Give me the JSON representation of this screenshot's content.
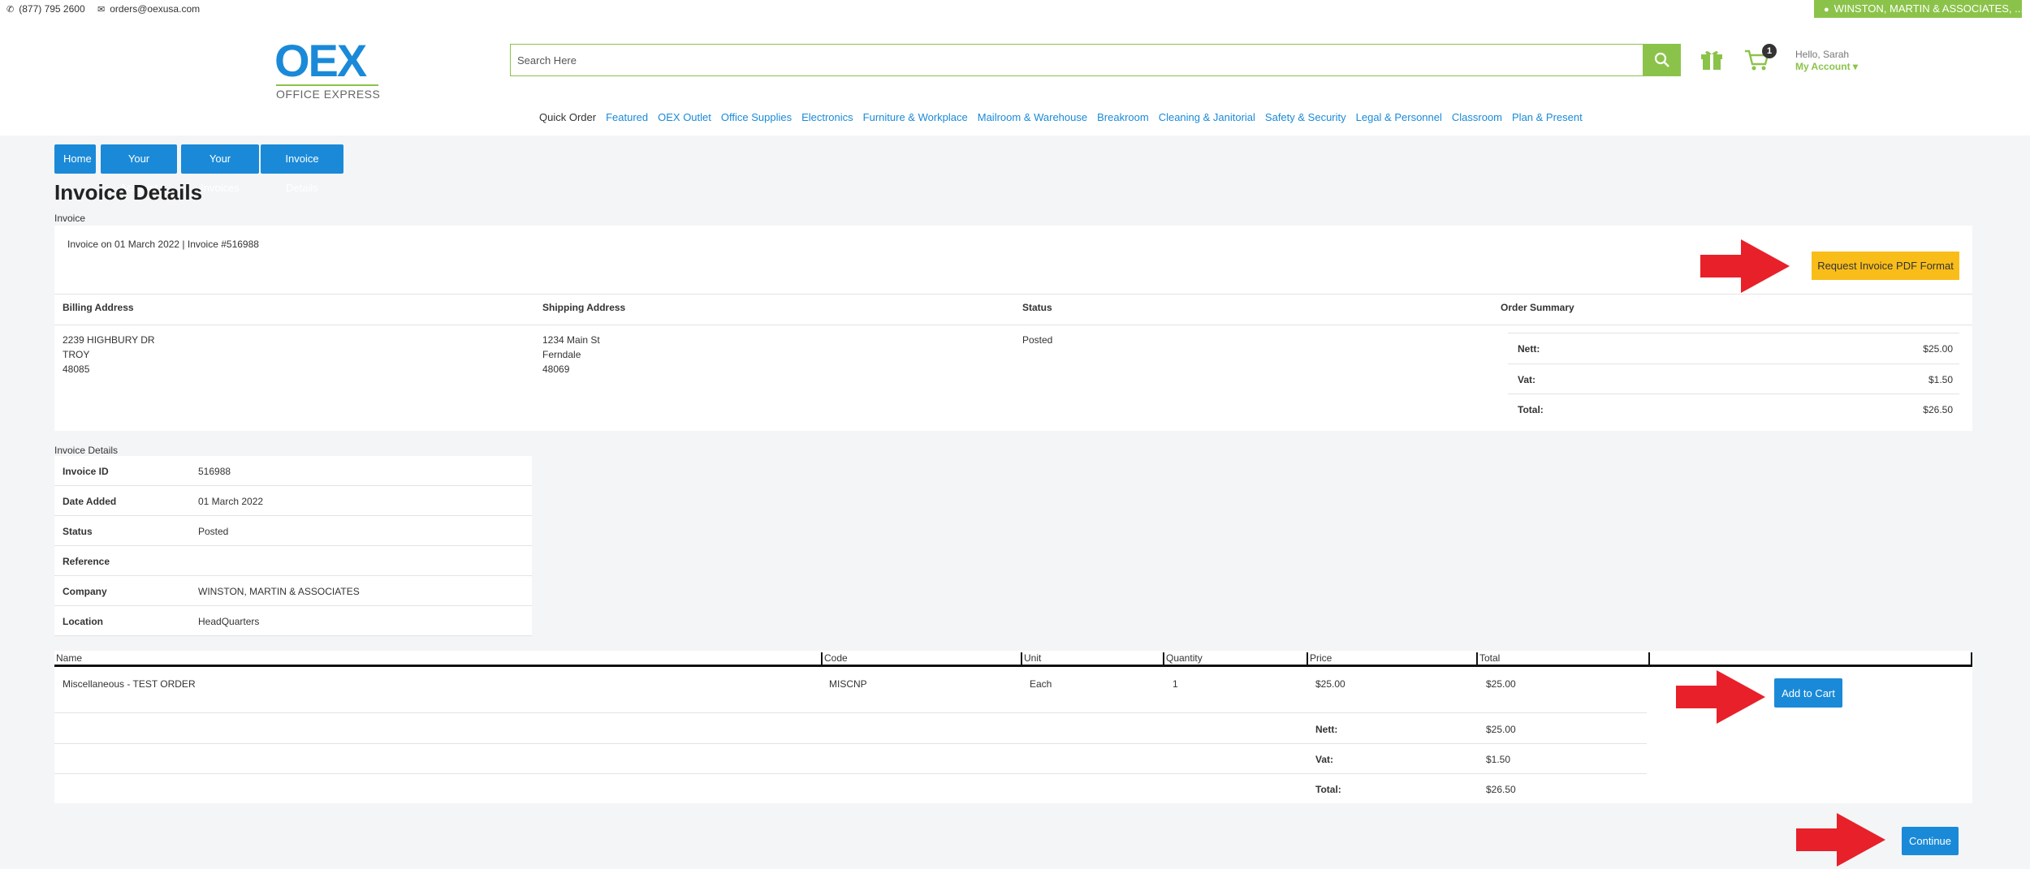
{
  "topbar": {
    "phone": "(877) 795 2600",
    "email": "orders@oexusa.com",
    "company": "WINSTON, MARTIN & ASSOCIATES, ..."
  },
  "header": {
    "logo_text": "OEX",
    "logo_sub": "OFFICE EXPRESS",
    "search_placeholder": "Search Here",
    "cart_count": "1",
    "greeting": "Hello, Sarah",
    "my_account": "My Account ▾"
  },
  "nav": {
    "items": [
      "Quick Order",
      "Featured",
      "OEX Outlet",
      "Office Supplies",
      "Electronics",
      "Furniture & Workplace",
      "Mailroom & Warehouse",
      "Breakroom",
      "Cleaning & Janitorial",
      "Safety & Security",
      "Legal & Personnel",
      "Classroom",
      "Plan & Present"
    ]
  },
  "breadcrumb": [
    "Home",
    "Your Account",
    "Your Invoices",
    "Invoice Details"
  ],
  "page": {
    "title": "Invoice Details",
    "invoice_label": "Invoice",
    "invoice_line": "Invoice on 01 March 2022 | Invoice #516988",
    "pdf_button": "Request Invoice PDF Format"
  },
  "addresses": {
    "billing_head": "Billing Address",
    "billing": [
      "2239 HIGHBURY DR",
      "TROY",
      "48085"
    ],
    "shipping_head": "Shipping Address",
    "shipping": [
      "1234 Main St",
      "Ferndale",
      "48069"
    ],
    "status_head": "Status",
    "status": "Posted",
    "summary_head": "Order Summary"
  },
  "summary": {
    "nett_label": "Nett:",
    "nett": "$25.00",
    "vat_label": "Vat:",
    "vat": "$1.50",
    "total_label": "Total:",
    "total": "$26.50"
  },
  "details": {
    "label": "Invoice Details",
    "rows": [
      {
        "k": "Invoice ID",
        "v": "516988"
      },
      {
        "k": "Date Added",
        "v": "01 March 2022"
      },
      {
        "k": "Status",
        "v": "Posted"
      },
      {
        "k": "Reference",
        "v": ""
      },
      {
        "k": "Company",
        "v": "WINSTON, MARTIN & ASSOCIATES"
      },
      {
        "k": "Location",
        "v": "HeadQuarters"
      }
    ]
  },
  "items": {
    "headers": [
      "Name",
      "Code",
      "Unit",
      "Quantity",
      "Price",
      "Total",
      ""
    ],
    "row": {
      "name": "Miscellaneous - TEST ORDER",
      "code": "MISCNP",
      "unit": "Each",
      "qty": "1",
      "price": "$25.00",
      "total": "$25.00"
    },
    "add_to_cart": "Add to Cart",
    "nett_label": "Nett:",
    "nett": "$25.00",
    "vat_label": "Vat:",
    "vat": "$1.50",
    "total_label": "Total:",
    "total": "$26.50"
  },
  "continue_button": "Continue",
  "colors": {
    "blue": "#1a8ad8",
    "green": "#8bc34a",
    "yellow": "#f9bd1a",
    "arrow_red": "#e8202a"
  }
}
